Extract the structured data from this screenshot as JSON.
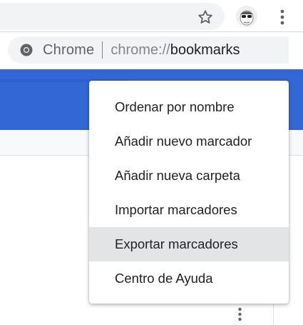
{
  "toolbar": {
    "bookmark_star": "star-icon",
    "profile_avatar": "avatar-icon",
    "menu_icon": "kebab-icon"
  },
  "omnibox": {
    "site_label": "Chrome",
    "url_scheme": "chrome://",
    "url_host": "bookmarks"
  },
  "colors": {
    "header_blue": "#3367d6",
    "highlight": "#e3e4e6"
  },
  "menu": {
    "items": [
      {
        "label": "Ordenar por nombre"
      },
      {
        "label": "Añadir nuevo marcador"
      },
      {
        "label": "Añadir nueva carpeta"
      },
      {
        "label": "Importar marcadores"
      },
      {
        "label": "Exportar marcadores"
      },
      {
        "label": "Centro de Ayuda"
      }
    ],
    "highlighted_index": 4
  }
}
